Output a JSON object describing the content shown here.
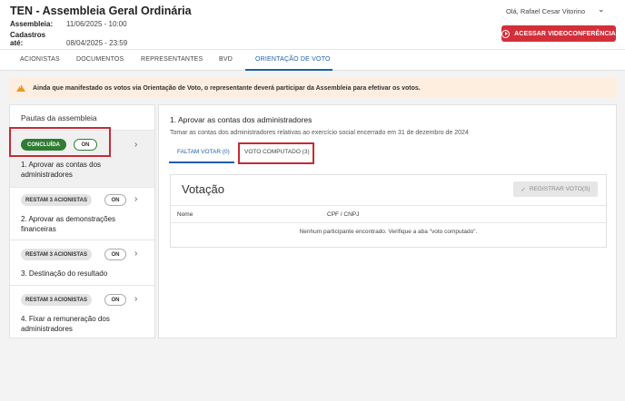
{
  "header": {
    "title": "TEN - Assembleia Geral Ordinária",
    "assembly_label": "Assembleia:",
    "assembly_value": "11/06/2025 - 10:00",
    "cadastros_label": "Cadastros até:",
    "cadastros_value": "08/04/2025 - 23:59",
    "user_greeting": "Olá, Rafael Cesar Vitorino",
    "video_button": "ACESSAR VIDEOCONFERÊNCIA"
  },
  "tabs": [
    "ACIONISTAS",
    "DOCUMENTOS",
    "REPRESENTANTES",
    "BVD",
    "ORIENTAÇÃO DE VOTO"
  ],
  "active_tab": "ORIENTAÇÃO DE VOTO",
  "warning": "Ainda que manifestado os votos via Orientação de Voto, o representante deverá participar da Assembleia para efetivar os votos.",
  "colors": {
    "accent": "#1e5fa8",
    "video_button": "#d32f3a",
    "done_green": "#2e7d32",
    "warning_bg": "#fdeee0",
    "highlight_box": "#c42b36"
  },
  "left_panel": {
    "title": "Pautas da assembleia",
    "items": [
      {
        "status": "CONCLUÍDA",
        "toggle": "ON",
        "label": "1. Aprovar as contas dos administradores",
        "selected": true
      },
      {
        "status": "RESTAM 3 ACIONISTAS",
        "toggle": "ON",
        "label": "2. Aprovar as demonstrações financeiras",
        "selected": false
      },
      {
        "status": "RESTAM 3 ACIONISTAS",
        "toggle": "ON",
        "label": "3. Destinação do resultado",
        "selected": false
      },
      {
        "status": "RESTAM 3 ACIONISTAS",
        "toggle": "ON",
        "label": "4. Fixar a remuneração dos administradores",
        "selected": false
      }
    ]
  },
  "main": {
    "title": "1. Aprovar as contas dos administradores",
    "description": "Tomar as contas dos administradores relativas ao exercício social encerrado em 31 de dezembro de 2024",
    "subtabs": [
      "FALTAM VOTAR (0)",
      "VOTO COMPUTADO (3)"
    ],
    "active_subtab": "FALTAM VOTAR (0)",
    "votacao": {
      "title": "Votação",
      "register_button": "REGISTRAR VOTO(S)",
      "columns": [
        "Nome",
        "CPF / CNPJ"
      ],
      "empty_message": "Nenhum participante encontrado. Verifique a aba \"voto computado\"."
    }
  }
}
